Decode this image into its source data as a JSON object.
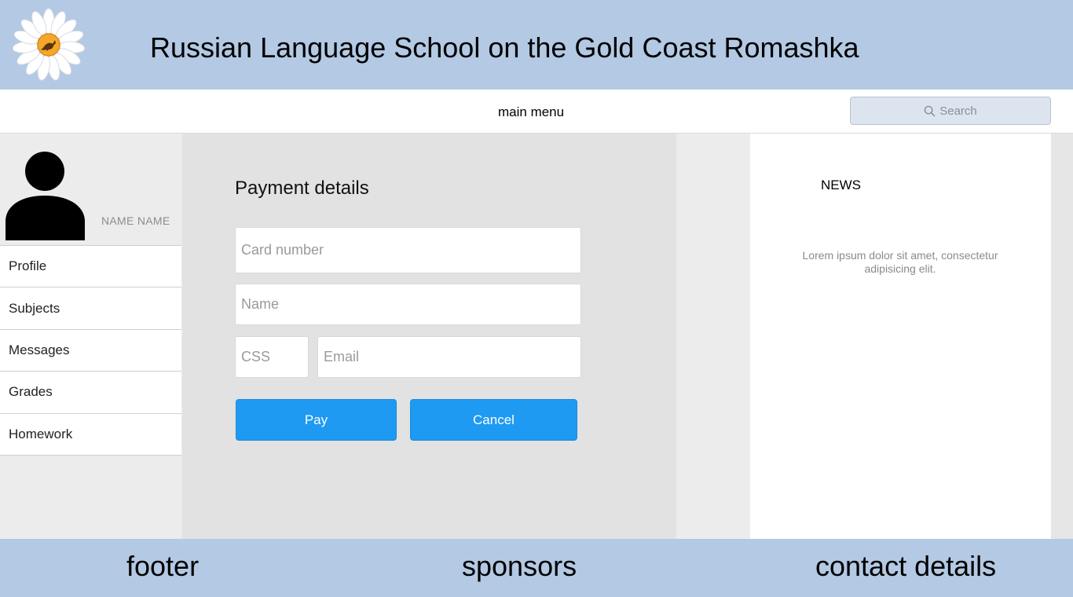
{
  "header": {
    "title": "Russian Language School on the Gold Coast Romashka",
    "logo_icon": "daisy-kangaroo-logo"
  },
  "menubar": {
    "label": "main menu",
    "search_placeholder": "Search"
  },
  "sidebar": {
    "user_name": "NAME NAME",
    "items": [
      {
        "label": "Profile"
      },
      {
        "label": "Subjects"
      },
      {
        "label": "Messages"
      },
      {
        "label": "Grades"
      },
      {
        "label": "Homework"
      }
    ]
  },
  "payment": {
    "title": "Payment details",
    "card_placeholder": "Card number",
    "name_placeholder": "Name",
    "css_placeholder": "CSS",
    "email_placeholder": "Email",
    "pay_label": "Pay",
    "cancel_label": "Cancel"
  },
  "news": {
    "title": "NEWS",
    "body": "Lorem ipsum dolor sit amet, consectetur adipisicing elit."
  },
  "footer": {
    "left": "footer",
    "center": "sponsors",
    "right": "contact details"
  },
  "colors": {
    "header_bg": "#b3c9e4",
    "button_bg": "#1e9af2"
  }
}
